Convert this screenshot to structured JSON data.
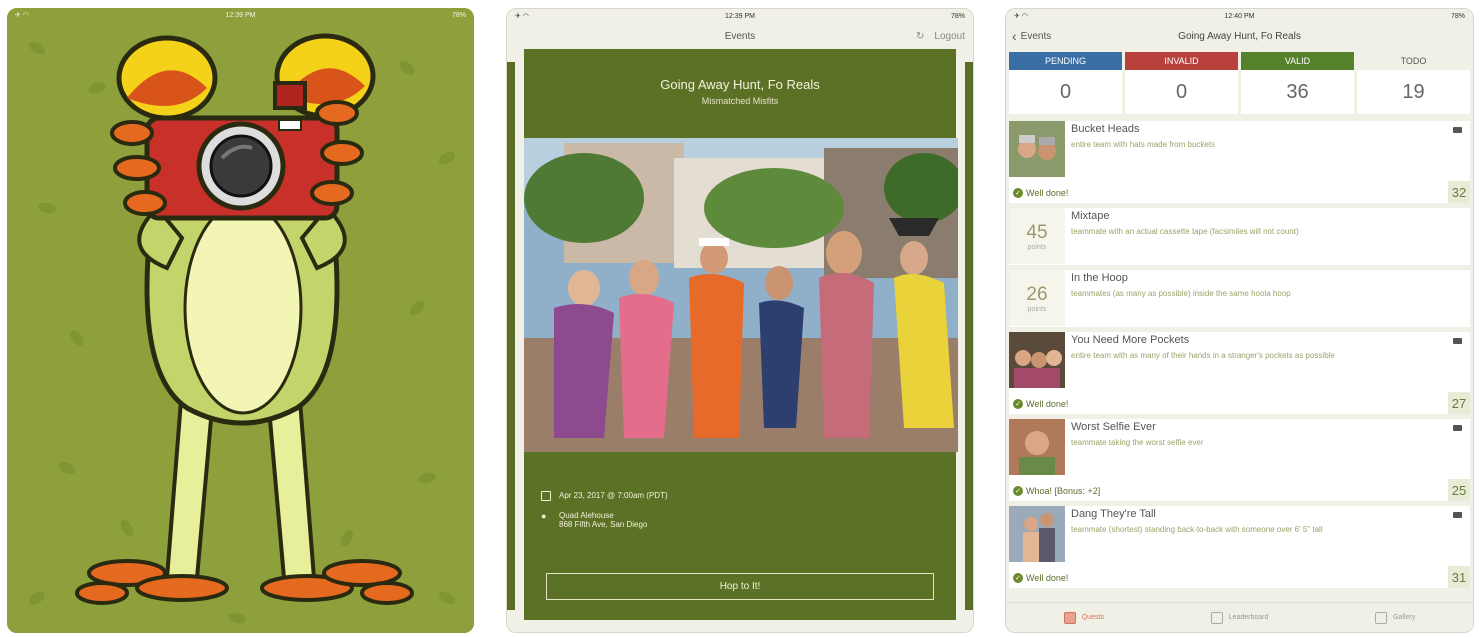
{
  "screen1": {
    "status_time": "12:39 PM",
    "status_battery": "78%"
  },
  "screen2": {
    "status_time": "12:39 PM",
    "status_battery": "78%",
    "nav_title": "Events",
    "logout_label": "Logout",
    "event_title": "Going Away Hunt, Fo Reals",
    "event_subtitle": "Mismatched Misfits",
    "date_text": "Apr 23, 2017 @ 7:00am (PDT)",
    "venue_name": "Quad Alehouse",
    "venue_address": "868 Fifth Ave, San Diego",
    "cta_label": "Hop to It!"
  },
  "screen3": {
    "status_time": "12:40 PM",
    "status_battery": "78%",
    "back_label": "Events",
    "nav_title": "Going Away Hunt, Fo Reals",
    "stats": [
      {
        "label": "PENDING",
        "value": "0",
        "color": "#3a6fa6"
      },
      {
        "label": "INVALID",
        "value": "0",
        "color": "#b8413c"
      },
      {
        "label": "VALID",
        "value": "36",
        "color": "#55802c"
      },
      {
        "label": "TODO",
        "value": "19",
        "color": "#f1f0e6"
      }
    ],
    "quests": [
      {
        "name": "Bucket Heads",
        "desc": "entire team with hats made from buckets",
        "status": "Well done!",
        "score": "32"
      },
      {
        "name": "Mixtape",
        "desc": "teammate with an actual cassette tape (facsimiles will not count)",
        "points": "45",
        "points_label": "points"
      },
      {
        "name": "In the Hoop",
        "desc": "teammates (as many as possible) inside the same hoola hoop",
        "points": "26",
        "points_label": "points"
      },
      {
        "name": "You Need More Pockets",
        "desc": "entire team with as many of their hands in a stranger's pockets as possible",
        "status": "Well done!",
        "score": "27"
      },
      {
        "name": "Worst Selfie Ever",
        "desc": "teammate taking the worst selfie ever",
        "status": "Whoa! [Bonus: +2]",
        "score": "25"
      },
      {
        "name": "Dang They're Tall",
        "desc": "teammate (shortest) standing back-to-back with someone over 6' 5\" tall",
        "status": "Well done!",
        "score": "31"
      }
    ],
    "tabs": [
      {
        "label": "Quests",
        "icon": "quests-icon"
      },
      {
        "label": "Leaderboard",
        "icon": "trophy-icon"
      },
      {
        "label": "Gallery",
        "icon": "gallery-icon"
      }
    ]
  }
}
